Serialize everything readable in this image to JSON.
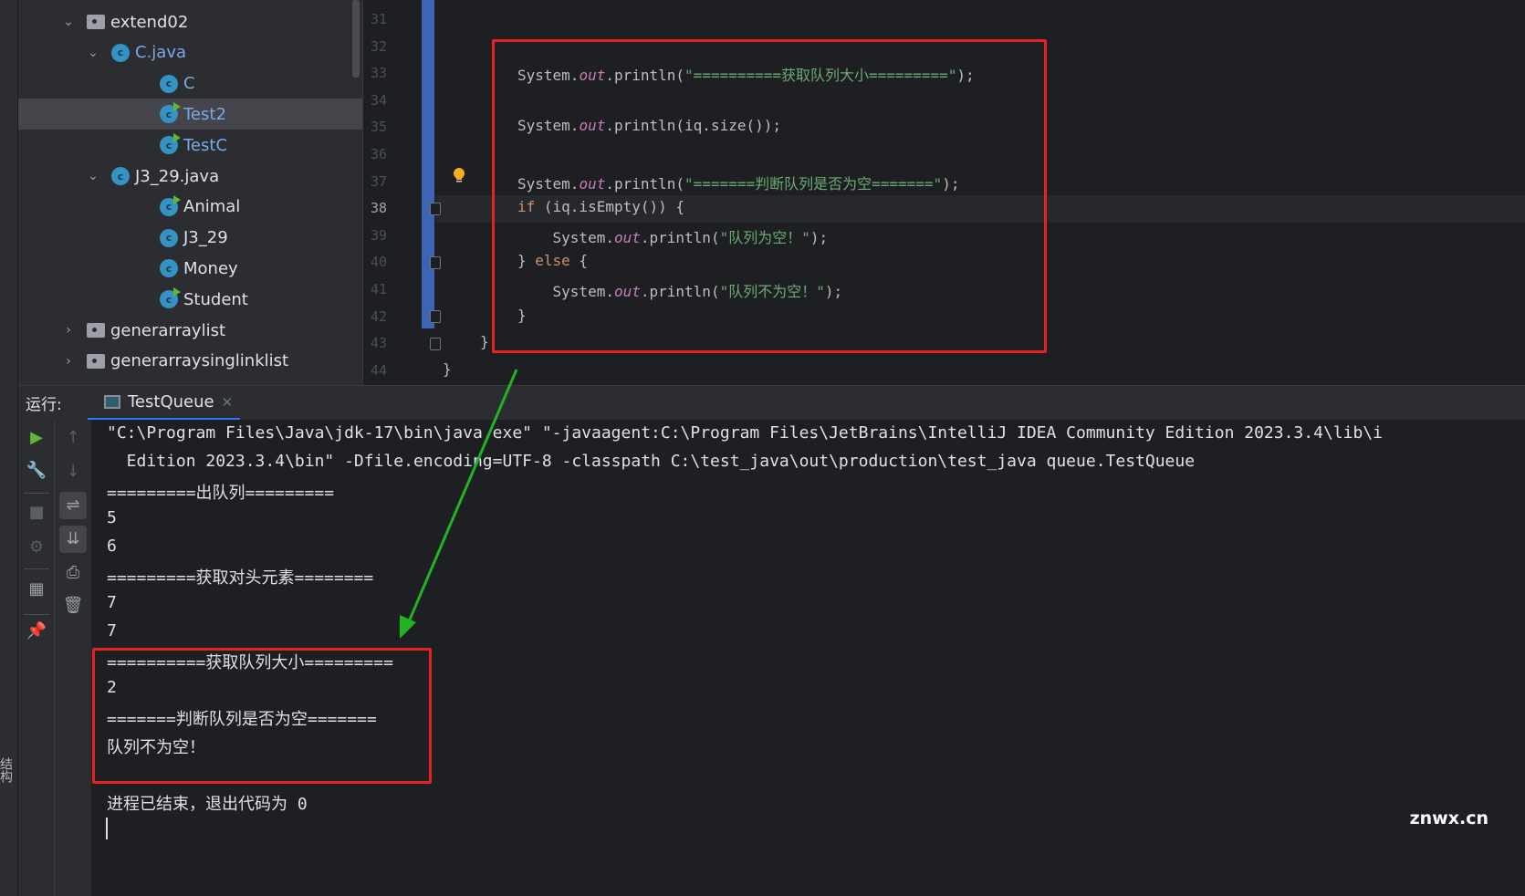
{
  "tree": [
    {
      "label": "extend02",
      "type": "folder",
      "expanded": true,
      "level": 0
    },
    {
      "label": "C.java",
      "type": "file",
      "expanded": true,
      "level": 1,
      "blue": true
    },
    {
      "label": "C",
      "type": "class",
      "level": 2,
      "blue": true
    },
    {
      "label": "Test2",
      "type": "class-run",
      "level": 2,
      "blue": true,
      "selected": true
    },
    {
      "label": "TestC",
      "type": "class-run",
      "level": 2,
      "blue": true
    },
    {
      "label": "J3_29.java",
      "type": "file",
      "expanded": true,
      "level": 1
    },
    {
      "label": "Animal",
      "type": "class-run",
      "level": 2
    },
    {
      "label": "J3_29",
      "type": "class",
      "level": 2
    },
    {
      "label": "Money",
      "type": "class",
      "level": 2
    },
    {
      "label": "Student",
      "type": "class-run",
      "level": 2
    },
    {
      "label": "generarraylist",
      "type": "folder",
      "expanded": false,
      "level": 0
    },
    {
      "label": "generarraysinglinklist",
      "type": "folder",
      "expanded": false,
      "level": 0
    }
  ],
  "editor": {
    "line_numbers": [
      "31",
      "32",
      "33",
      "34",
      "35",
      "36",
      "37",
      "38",
      "39",
      "40",
      "41",
      "42",
      "43",
      "44"
    ],
    "current_line": "38",
    "lines": [
      [],
      [],
      [
        [
          "System.",
          ""
        ],
        [
          "out",
          "f"
        ],
        [
          ".println(",
          ""
        ],
        [
          "\"==========获取队列大小=========\"",
          "s"
        ],
        [
          ");",
          ""
        ]
      ],
      [],
      [
        [
          "System.",
          ""
        ],
        [
          "out",
          "f"
        ],
        [
          ".println(iq.size());",
          ""
        ]
      ],
      [],
      [
        [
          "System.",
          ""
        ],
        [
          "out",
          "f"
        ],
        [
          ".println(",
          ""
        ],
        [
          "\"=======判断队列是否为空=======\"",
          "s"
        ],
        [
          ");",
          ""
        ]
      ],
      [
        [
          "if",
          "k"
        ],
        [
          " (iq.isEmpty()) {",
          ""
        ]
      ],
      [
        [
          "    System.",
          ""
        ],
        [
          "out",
          "f"
        ],
        [
          ".println(",
          ""
        ],
        [
          "\"队列为空！\"",
          "s"
        ],
        [
          ");",
          ""
        ]
      ],
      [
        [
          "} ",
          ""
        ],
        [
          "else",
          "k"
        ],
        [
          " {",
          ""
        ]
      ],
      [
        [
          "    System.",
          ""
        ],
        [
          "out",
          "f"
        ],
        [
          ".println(",
          ""
        ],
        [
          "\"队列不为空！\"",
          "s"
        ],
        [
          ");",
          ""
        ]
      ],
      [
        [
          "}",
          ""
        ]
      ],
      [
        [
          "}",
          ""
        ]
      ],
      [
        [
          "}",
          ""
        ]
      ]
    ]
  },
  "run": {
    "label": "运行:",
    "tab": "TestQueue"
  },
  "console": {
    "lines": [
      "\"C:\\Program Files\\Java\\jdk-17\\bin\\java.exe\" \"-javaagent:C:\\Program Files\\JetBrains\\IntelliJ IDEA Community Edition 2023.3.4\\lib\\i",
      "  Edition 2023.3.4\\bin\" -Dfile.encoding=UTF-8 -classpath C:\\test_java\\out\\production\\test_java queue.TestQueue",
      "=========出队列=========",
      "5",
      "6",
      "=========获取对头元素========",
      "7",
      "7",
      "==========获取队列大小=========",
      "2",
      "=======判断队列是否为空=======",
      "队列不为空！",
      "",
      "进程已结束，退出代码为 0"
    ]
  },
  "side_label": "结构",
  "watermark": "znwx.cn",
  "colors": {
    "annotation_box": "#e8231f",
    "arrow": "#22b322",
    "accent": "#3574f0"
  }
}
